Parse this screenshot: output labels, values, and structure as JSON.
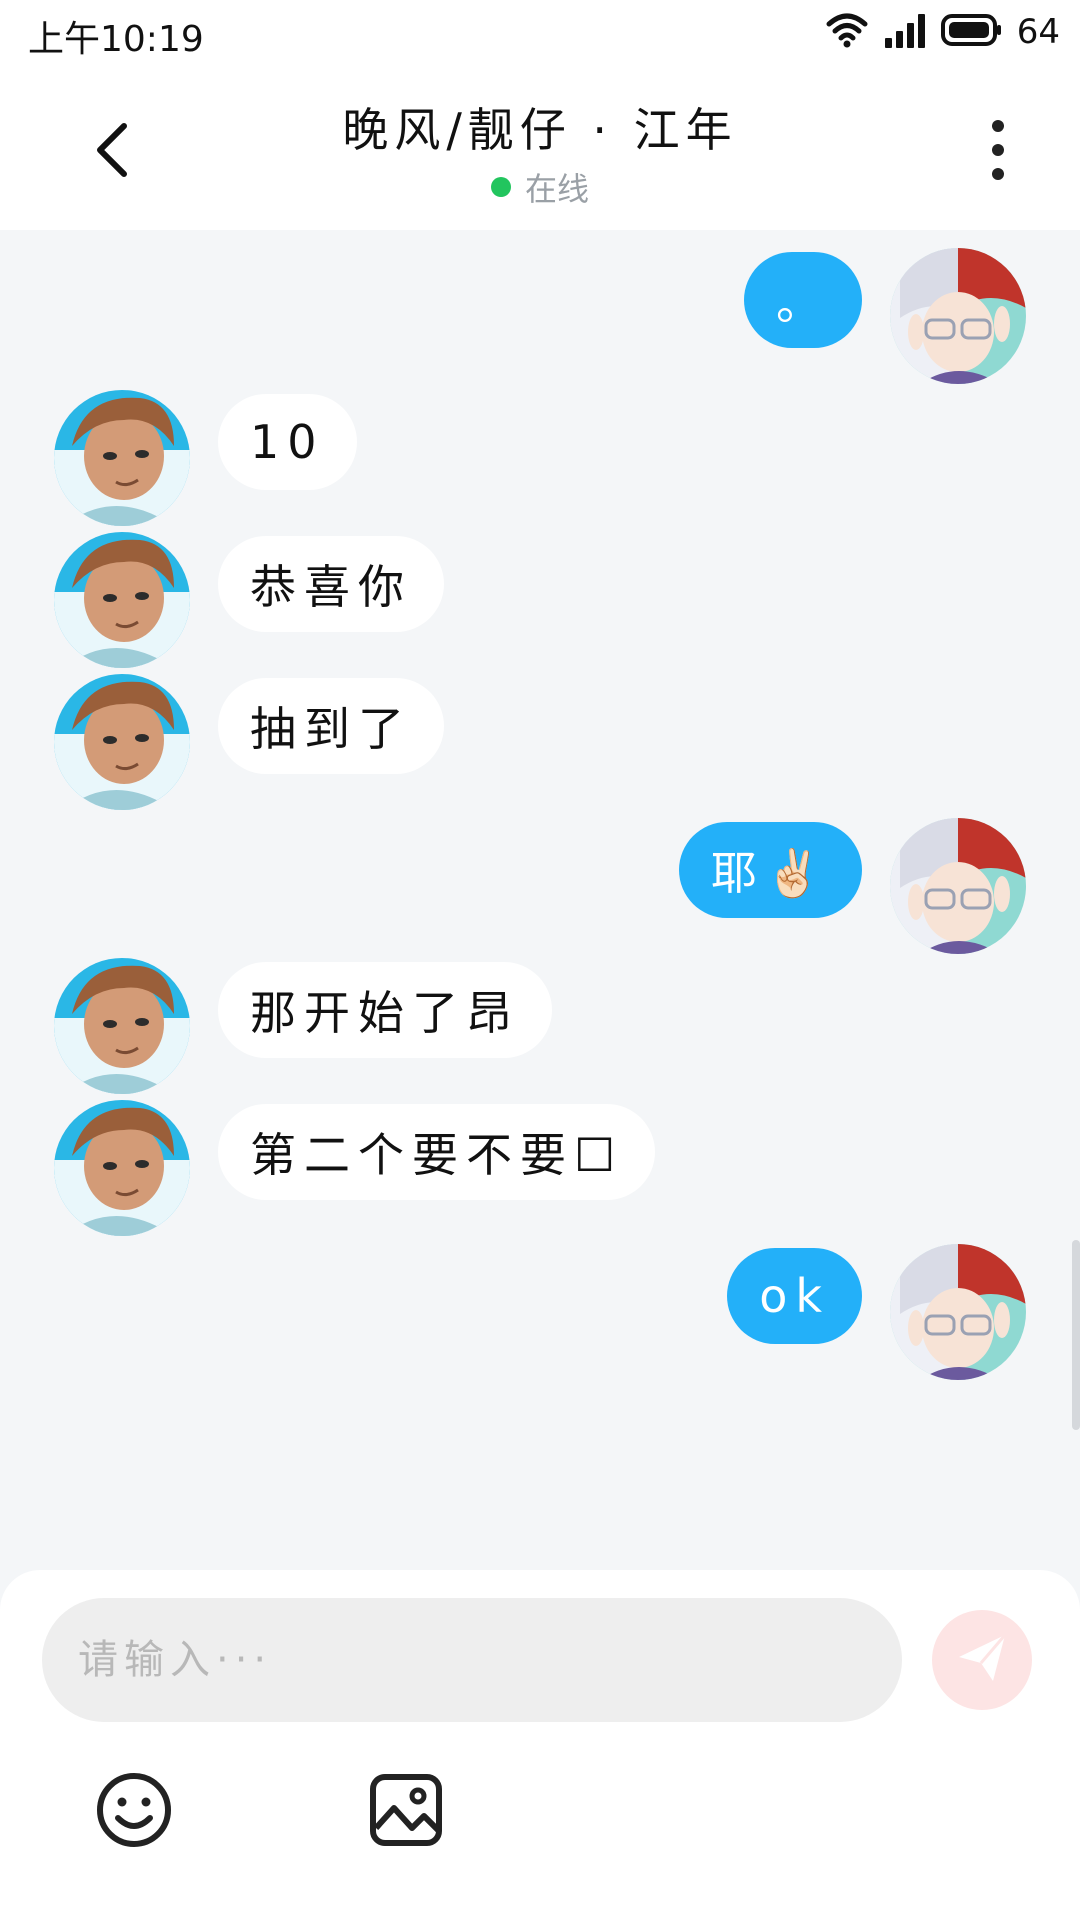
{
  "status_bar": {
    "time": "上午10:19",
    "battery": "64"
  },
  "header": {
    "title": "晚风/靓仔 · 江年",
    "status": "在线"
  },
  "messages": [
    {
      "side": "right",
      "text": "。"
    },
    {
      "side": "left",
      "text": "10"
    },
    {
      "side": "left",
      "text": "恭喜你"
    },
    {
      "side": "left",
      "text": "抽到了"
    },
    {
      "side": "right",
      "text": "耶✌🏻"
    },
    {
      "side": "left",
      "text": "那开始了昂"
    },
    {
      "side": "left",
      "text": "第二个要不要☐"
    },
    {
      "side": "right",
      "text": "ok"
    }
  ],
  "composer": {
    "placeholder": "请输入···"
  },
  "icons": {
    "back": "chevron-left-icon",
    "more": "more-vertical-icon",
    "send": "send-icon",
    "emoji": "smiley-icon",
    "image": "image-icon",
    "wifi": "wifi-icon",
    "signal": "signal-icon",
    "battery": "battery-icon"
  },
  "colors": {
    "accent": "#23b0f9",
    "online": "#22c55e",
    "background": "#f4f6f8"
  }
}
